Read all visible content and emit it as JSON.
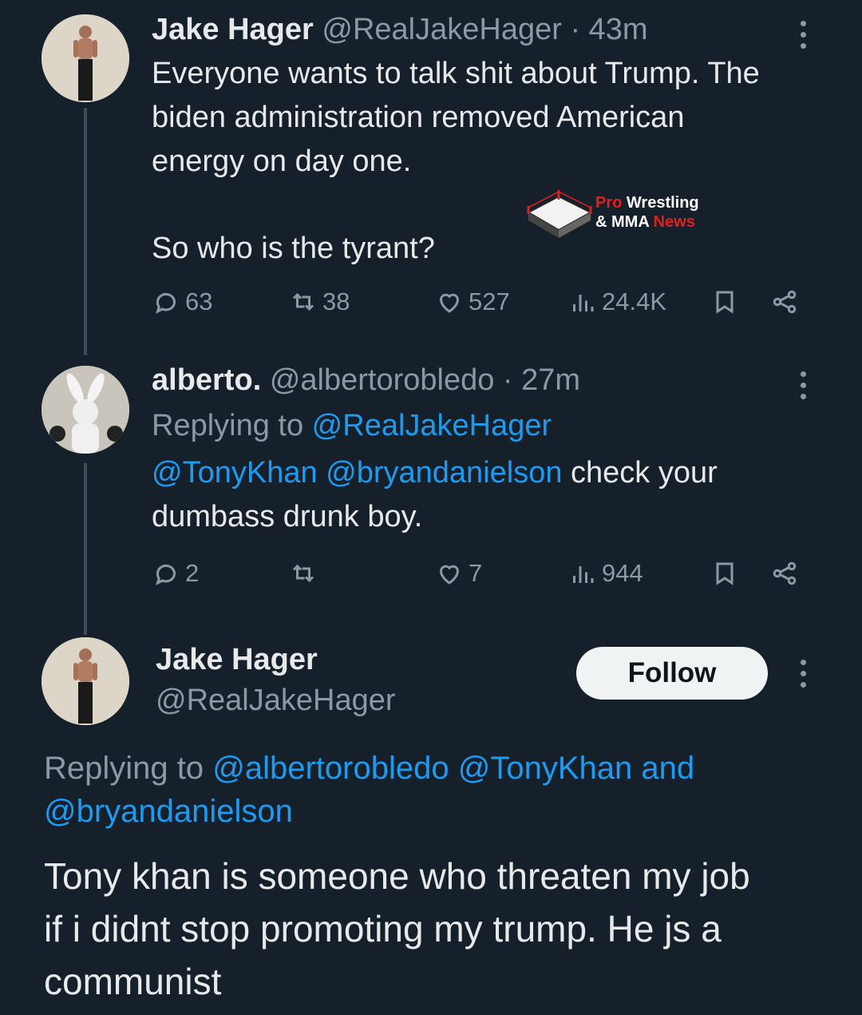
{
  "tweet1": {
    "name": "Jake Hager",
    "handle": "@RealJakeHager",
    "time": "· 43m",
    "text_line1": "Everyone wants to talk shit about Trump. The",
    "text_line2": "biden administration removed American",
    "text_line3": "energy on day one.",
    "text_line4": "So who is the tyrant?",
    "replies": "63",
    "retweets": "38",
    "likes": "527",
    "views": "24.4K"
  },
  "watermark": {
    "line1_red": "Pro",
    "line1_white": " Wrestling",
    "line2_white": "& MMA ",
    "line2_red": "News"
  },
  "tweet2": {
    "name": "alberto.",
    "handle": "@albertorobledo",
    "time": "· 27m",
    "replying_label": "Replying to ",
    "replying_to": "@RealJakeHager",
    "mention1": "@TonyKhan",
    "mention2": "@bryandanielson",
    "text_rest": " check your",
    "text_line2": "dumbass drunk boy.",
    "replies": "2",
    "retweets": "",
    "likes": "7",
    "views": "944"
  },
  "tweet3": {
    "name": "Jake Hager",
    "handle": "@RealJakeHager",
    "follow_label": "Follow",
    "replying_label": "Replying to ",
    "replying_to1": "@albertorobledo",
    "replying_to2": "@TonyKhan",
    "replying_and": "and",
    "replying_to3": "@bryandanielson",
    "text_line1": "Tony khan is someone who threaten my job",
    "text_line2": "if i didnt stop promoting my trump. He js a",
    "text_line3": "communist"
  },
  "icons": [
    "reply-icon",
    "retweet-icon",
    "like-icon",
    "views-icon",
    "bookmark-icon",
    "share-icon",
    "more-icon"
  ],
  "colors": {
    "background": "#15202b",
    "link": "#1d9bf0",
    "muted": "#8b98a5",
    "text": "#e7e9ea"
  }
}
